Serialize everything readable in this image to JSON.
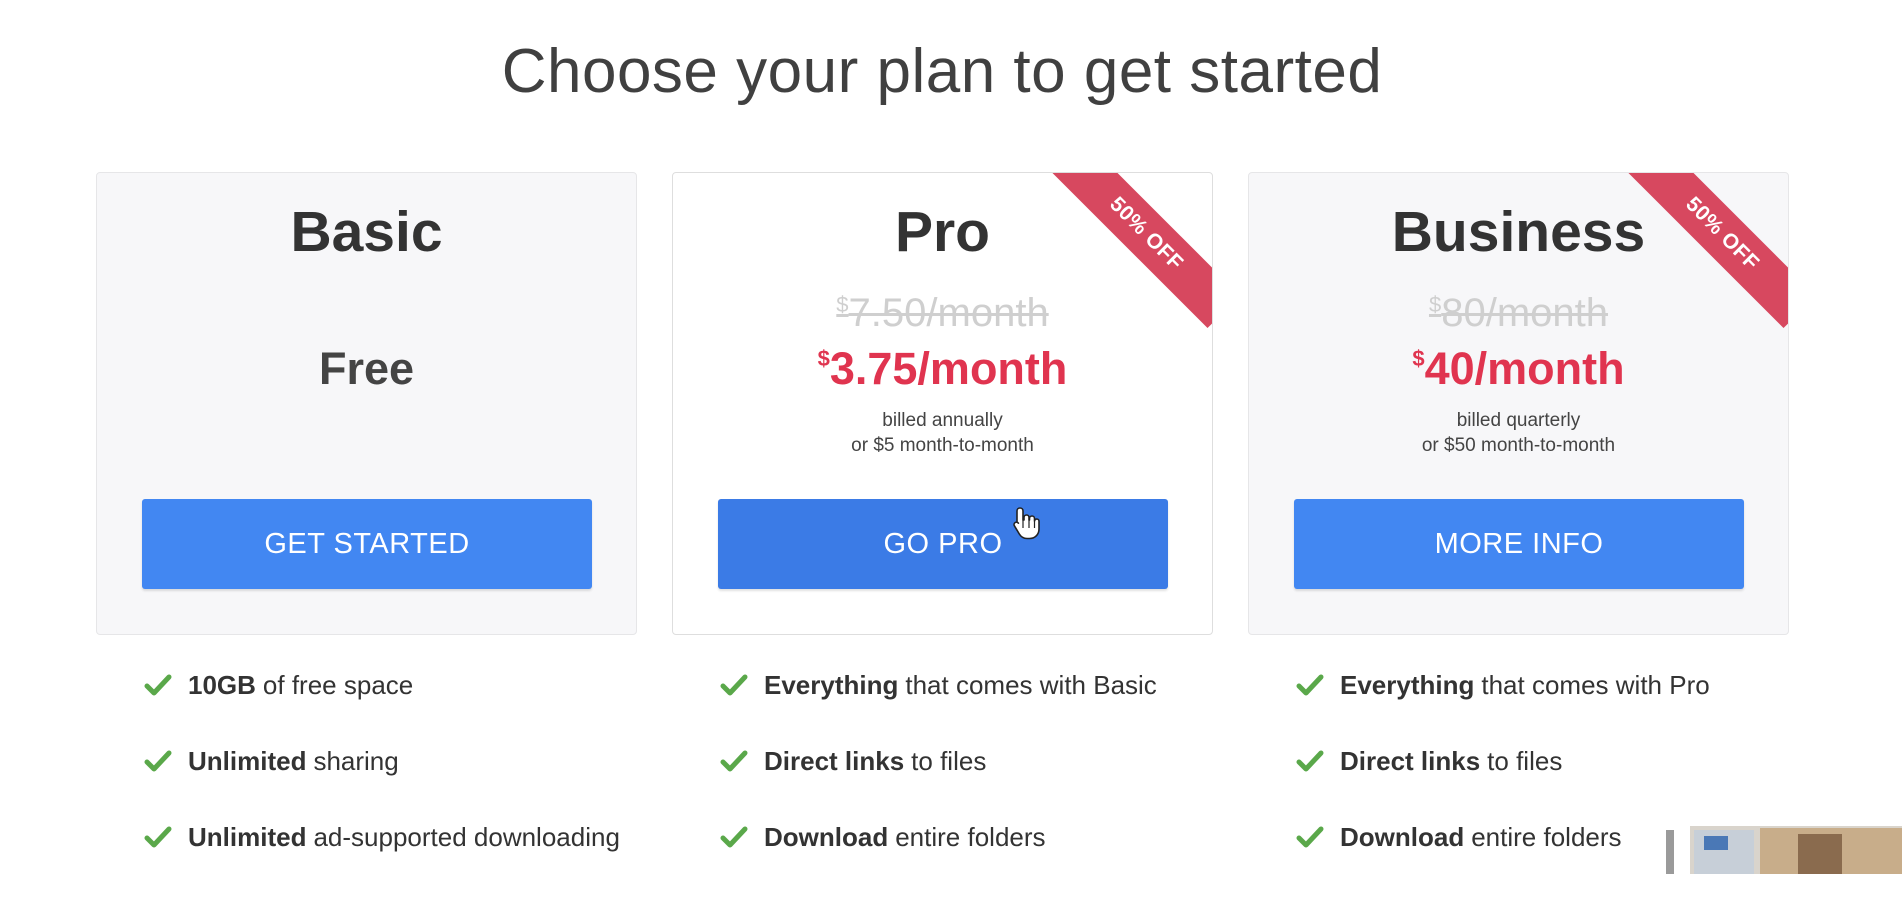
{
  "page": {
    "title": "Choose your plan to get started"
  },
  "colors": {
    "accent": "#4287f2",
    "sale": "#e0344f",
    "ribbon": "#d7485f",
    "check": "#5aa84a"
  },
  "plans": [
    {
      "name": "Basic",
      "price_label": "Free",
      "button_label": "GET STARTED",
      "features": [
        {
          "bold": "10GB",
          "text": "of free space"
        },
        {
          "bold": "Unlimited",
          "text": "sharing"
        },
        {
          "bold": "Unlimited",
          "text": "ad-supported downloading"
        }
      ]
    },
    {
      "name": "Pro",
      "ribbon": "50% OFF",
      "currency": "$",
      "old_price": "7.50/month",
      "new_price": "3.75/month",
      "billing_line1": "billed annually",
      "billing_line2": "or $5 month-to-month",
      "button_label": "GO PRO",
      "features": [
        {
          "bold": "Everything",
          "text": "that comes with Basic"
        },
        {
          "bold": "Direct links",
          "text": "to files"
        },
        {
          "bold": "Download",
          "text": "entire folders"
        }
      ]
    },
    {
      "name": "Business",
      "ribbon": "50% OFF",
      "currency": "$",
      "old_price": "80/month",
      "new_price": "40/month",
      "billing_line1": "billed quarterly",
      "billing_line2": "or $50 month-to-month",
      "button_label": "MORE INFO",
      "features": [
        {
          "bold": "Everything",
          "text": "that comes with Pro"
        },
        {
          "bold": "Direct links",
          "text": "to files"
        },
        {
          "bold": "Download",
          "text": "entire folders"
        }
      ]
    }
  ]
}
